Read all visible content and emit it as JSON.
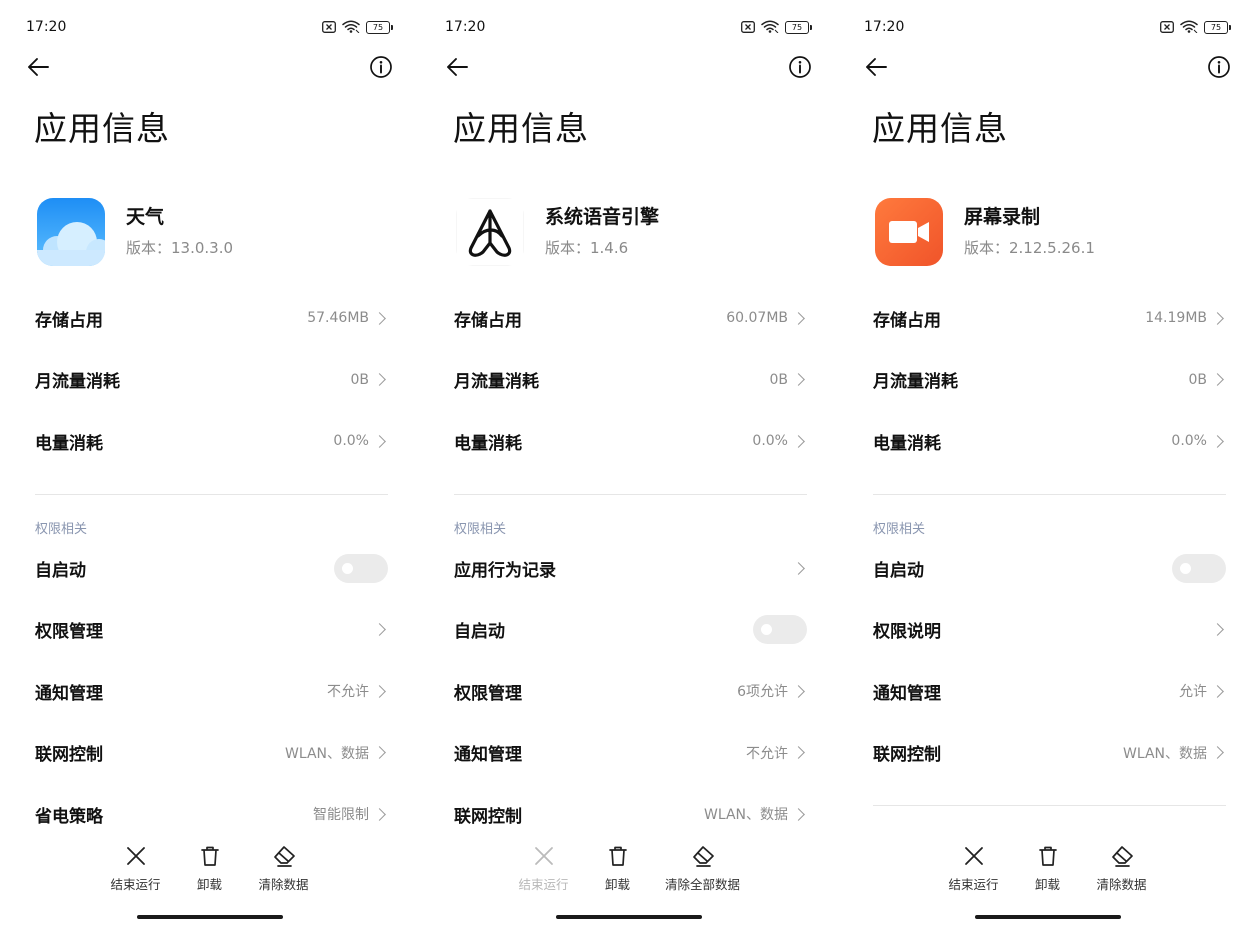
{
  "status": {
    "time": "17:20",
    "battery": "75"
  },
  "screen_title": "应用信息",
  "panels": [
    {
      "app": {
        "name": "天气",
        "version": "版本：13.0.3.0",
        "icon": "weather-cloud-icon"
      },
      "rows": [
        {
          "label": "存储占用",
          "value": "57.46MB"
        },
        {
          "label": "月流量消耗",
          "value": "0B"
        },
        {
          "label": "电量消耗",
          "value": "0.0%"
        }
      ],
      "section": "权限相关",
      "perm_rows": [
        {
          "label": "自启动",
          "type": "toggle"
        },
        {
          "label": "权限管理",
          "value": ""
        },
        {
          "label": "通知管理",
          "value": "不允许"
        },
        {
          "label": "联网控制",
          "value": "WLAN、数据"
        },
        {
          "label": "省电策略",
          "value": "智能限制"
        }
      ],
      "actions": [
        {
          "label": "结束运行",
          "icon": "close-icon",
          "disabled": false
        },
        {
          "label": "卸载",
          "icon": "trash-icon",
          "disabled": false
        },
        {
          "label": "清除数据",
          "icon": "eraser-icon",
          "disabled": false
        }
      ]
    },
    {
      "app": {
        "name": "系统语音引擎",
        "version": "版本：1.4.6",
        "icon": "voice-engine-logo-icon"
      },
      "rows": [
        {
          "label": "存储占用",
          "value": "60.07MB"
        },
        {
          "label": "月流量消耗",
          "value": "0B"
        },
        {
          "label": "电量消耗",
          "value": "0.0%"
        }
      ],
      "section": "权限相关",
      "perm_rows": [
        {
          "label": "应用行为记录",
          "value": ""
        },
        {
          "label": "自启动",
          "type": "toggle"
        },
        {
          "label": "权限管理",
          "value": "6项允许"
        },
        {
          "label": "通知管理",
          "value": "不允许"
        },
        {
          "label": "联网控制",
          "value": "WLAN、数据"
        }
      ],
      "actions": [
        {
          "label": "结束运行",
          "icon": "close-icon",
          "disabled": true
        },
        {
          "label": "卸载",
          "icon": "trash-icon",
          "disabled": false
        },
        {
          "label": "清除全部数据",
          "icon": "eraser-icon",
          "disabled": false
        }
      ]
    },
    {
      "app": {
        "name": "屏幕录制",
        "version": "版本：2.12.5.26.1",
        "icon": "screen-recorder-icon"
      },
      "rows": [
        {
          "label": "存储占用",
          "value": "14.19MB"
        },
        {
          "label": "月流量消耗",
          "value": "0B"
        },
        {
          "label": "电量消耗",
          "value": "0.0%"
        }
      ],
      "section": "权限相关",
      "perm_rows": [
        {
          "label": "自启动",
          "type": "toggle"
        },
        {
          "label": "权限说明",
          "value": ""
        },
        {
          "label": "通知管理",
          "value": "允许"
        },
        {
          "label": "联网控制",
          "value": "WLAN、数据"
        }
      ],
      "actions": [
        {
          "label": "结束运行",
          "icon": "close-icon",
          "disabled": false
        },
        {
          "label": "卸载",
          "icon": "trash-icon",
          "disabled": false
        },
        {
          "label": "清除数据",
          "icon": "eraser-icon",
          "disabled": false
        }
      ]
    }
  ]
}
